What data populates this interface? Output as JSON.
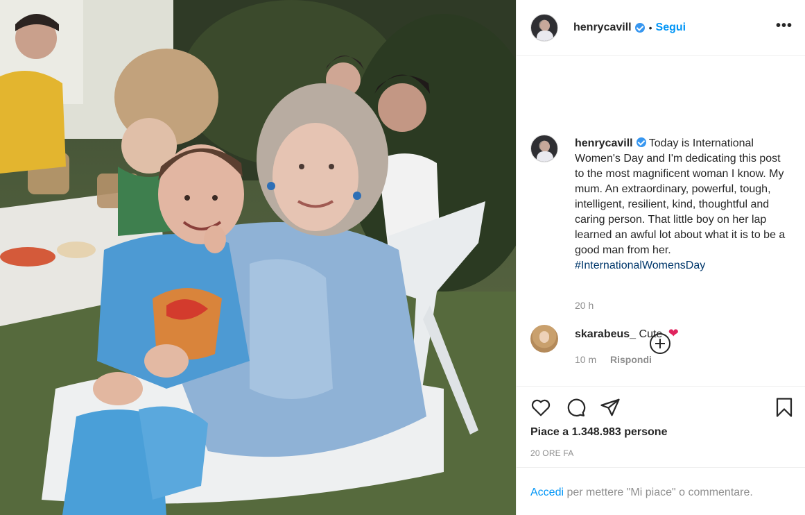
{
  "post": {
    "username": "henrycavill",
    "follow_label": "Segui",
    "dot": "•",
    "more_label": "•••",
    "caption_text": "Today is International Women's Day and I'm dedicating this post to the most magnificent woman I know. My mum. An extraordinary, powerful, tough, intelligent, resilient, kind, thoughtful and caring person. That little boy on her lap learned an awful lot about what it is to be a good man from her.",
    "hashtag": "#InternationalWomensDay",
    "caption_time": "20 h"
  },
  "comment": {
    "username": "skarabeus_",
    "text": "Cute",
    "emoji": "❤",
    "time": "10 m",
    "reply_label": "Rispondi"
  },
  "stats": {
    "likes_text": "Piace a 1.348.983 persone",
    "date_text": "20 ORE FA"
  },
  "footer": {
    "login_label": "Accedi",
    "rest_text": " per mettere \"Mi piace\" o commentare."
  },
  "icons": {
    "like": "heart-outline-icon",
    "comment": "speech-bubble-icon",
    "share": "paper-plane-icon",
    "save": "bookmark-icon",
    "add": "add-circle-icon",
    "verified": "verified-badge-icon"
  },
  "colors": {
    "link": "#0095f6",
    "hashtag": "#00376b",
    "muted": "#8e8e8e",
    "verified": "#3897f0"
  }
}
